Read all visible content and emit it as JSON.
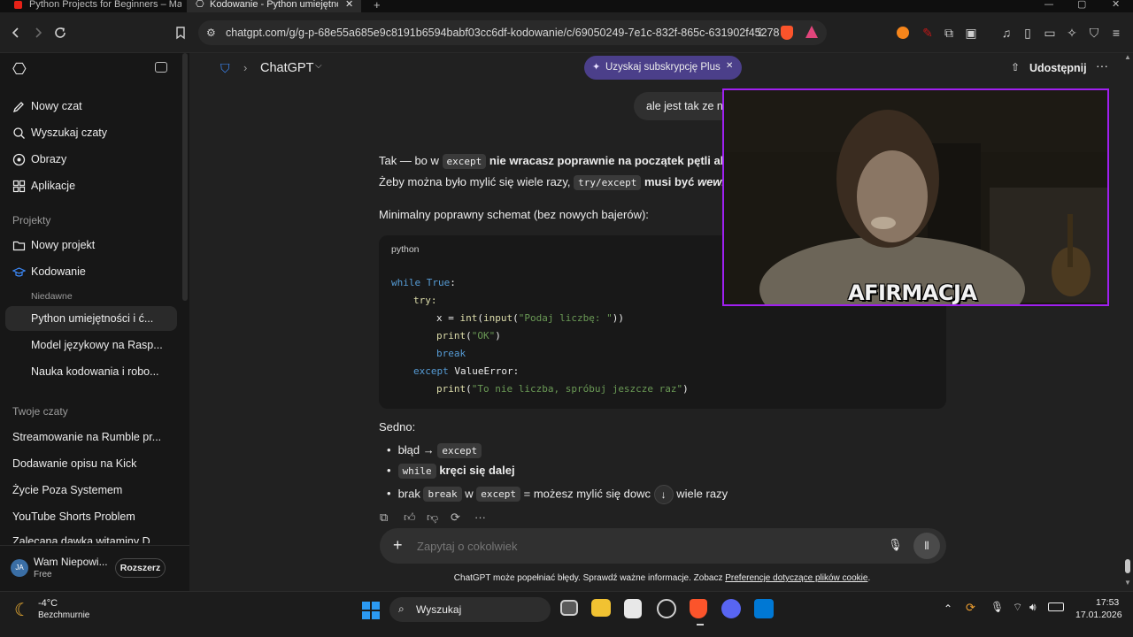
{
  "browser": {
    "tabs": [
      {
        "title": "Python Projects for Beginners – Mast"
      },
      {
        "title": "Kodowanie - Python umiejętnośc"
      }
    ],
    "new_tab": "+",
    "url": "chatgpt.com/g/g-p-68e55a685e9c8191b6594babf03cc6df-kodowanie/c/69050249-7e1c-832f-865c-631902f45278"
  },
  "sidebar": {
    "items": [
      {
        "label": "Nowy czat"
      },
      {
        "label": "Wyszukaj czaty"
      },
      {
        "label": "Obrazy"
      },
      {
        "label": "Aplikacje"
      }
    ],
    "projects_heading": "Projekty",
    "projects": [
      {
        "label": "Nowy projekt"
      },
      {
        "label": "Kodowanie"
      }
    ],
    "recent_heading": "Niedawne",
    "recent": [
      {
        "label": "Python umiejętności i ć..."
      },
      {
        "label": "Model językowy na Rasp..."
      },
      {
        "label": "Nauka kodowania i robo..."
      }
    ],
    "chats_heading": "Twoje czaty",
    "chats": [
      {
        "label": "Streamowanie na Rumble pr..."
      },
      {
        "label": "Dodawanie opisu na Kick"
      },
      {
        "label": "Życie Poza Systemem"
      },
      {
        "label": "YouTube Shorts Problem"
      },
      {
        "label": "Zalecana dawka witaminy D"
      }
    ],
    "user": {
      "initials": "JA",
      "name": "Wam Niepowi...",
      "plan": "Free",
      "upgrade": "Rozszerz"
    }
  },
  "header": {
    "model": "ChatGPT",
    "plus_button": "Uzyskaj subskrypcję Plus",
    "share": "Udostępnij"
  },
  "chat": {
    "user_message": "ale jest tak ze n",
    "line1_a": "Tak — bo w",
    "line1_code": "except",
    "line1_b": "nie wracasz poprawnie na początek pętli alb",
    "line2_a": "Żeby można było mylić się wiele razy,",
    "line2_code": "try/except",
    "line2_b": "musi być",
    "line2_c": "wewn",
    "schema_intro": "Minimalny poprawny schemat (bez nowych bajerów):",
    "code_lang": "python",
    "code_lines": {
      "l1a": "while",
      "l1b": "True",
      "l1c": ":",
      "l2": "try:",
      "l3a": "x = ",
      "l3b": "int",
      "l3c": "(",
      "l3d": "input",
      "l3e": "(",
      "l3f": "\"Podaj liczbę: \"",
      "l3g": "))",
      "l4a": "print",
      "l4b": "(",
      "l4c": "\"OK\"",
      "l4d": ")",
      "l5": "break",
      "l6a": "except",
      "l6b": "ValueError:",
      "l7a": "print",
      "l7b": "(",
      "l7c": "\"To nie liczba, spróbuj jeszcze raz\"",
      "l7d": ")"
    },
    "sedno": "Sedno:",
    "bullet1_a": "błąd →",
    "bullet1_code": "except",
    "bullet2_code": "while",
    "bullet2_b": "kręci się dalej",
    "bullet3_a": "brak",
    "bullet3_code1": "break",
    "bullet3_b": "w",
    "bullet3_code2": "except",
    "bullet3_c": "= możesz mylić się dowc",
    "bullet3_d": "wiele razy"
  },
  "composer": {
    "placeholder": "Zapytaj o cokolwiek",
    "disclaimer": "ChatGPT może popełniać błędy. Sprawdź ważne informacje. Zobacz",
    "disclaimer_link": "Preferencje dotyczące plików cookie",
    "disclaimer_end": "."
  },
  "overlay": {
    "caption": "AFIRMACJA",
    "accent": "#a020f0"
  },
  "taskbar": {
    "weather_temp": "-4°C",
    "weather_desc": "Bezchmurnie",
    "search": "Wyszukaj",
    "time": "17:53",
    "date": "17.01.2026"
  },
  "colors": {
    "sidebar_bg": "#171717",
    "main_bg": "#212121",
    "plus_bg": "#4b3f8a",
    "code_keyword": "#569cd6",
    "code_string": "#6a9955",
    "code_builtin": "#dcdcaa"
  }
}
